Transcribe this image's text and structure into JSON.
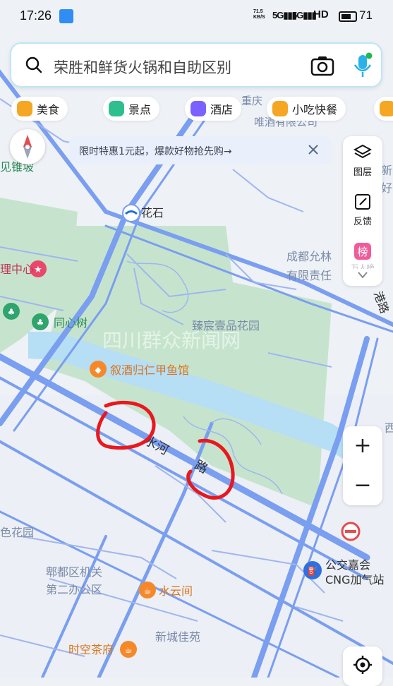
{
  "status_bar": {
    "time": "17:26",
    "net_speed_value": "71.5",
    "net_speed_unit": "KB/S",
    "signal_1": "5G",
    "signal_2": "5G",
    "hd": "HD",
    "battery": "71"
  },
  "search": {
    "query": "荣胜和鲜货火锅和自助区别"
  },
  "categories": [
    {
      "label": "美食",
      "color": "#f5a623"
    },
    {
      "label": "景点",
      "color": "#2fbf8f"
    },
    {
      "label": "酒店",
      "color": "#7b61ff"
    },
    {
      "label": "小吃快餐",
      "color": "#f5a623"
    }
  ],
  "notice": {
    "text": "限时特惠1元起，爆款好物抢先购→"
  },
  "side_panel": {
    "layers_label": "图层",
    "feedback_label": "反馈",
    "rank_badge": "榜",
    "rank_label": "万人榜"
  },
  "zoom": {
    "in_label": "+",
    "out_label": "−"
  },
  "map_labels": {
    "huashi": "花石",
    "top_company": "重庆",
    "top_company_2": "唯酒有限公司",
    "leftedge_top": "见锥坡",
    "rightedge_top_1": "新",
    "rightedge_top_2": "好",
    "chengdu_1": "成都允林",
    "chengdu_2": "有限责任",
    "leftedge_center": "理中心",
    "tongxinshu": "同心树",
    "zhenchen": "臻宸壹品花园",
    "watermark": "四川群众新闻网",
    "jiujiu": "叙酒归仁甲鱼馆",
    "road_vertical": "港路",
    "road_shuihe": "水河",
    "road_lu": "路",
    "xi": "西",
    "leftedge_garden": "色花园",
    "bus_station_1": "公交嘉会",
    "bus_station_2": "CNG加气站",
    "pidu_1": "郫都区机关",
    "pidu_2": "第二办公区",
    "shuiyunjian": "水云间",
    "xincheng": "新城佳苑",
    "shikong": "时空茶府"
  },
  "colors": {
    "road_main": "#7a9ef0",
    "road_minor": "#9fb6ee",
    "river": "#b6def5",
    "park": "#c6e4cd",
    "poi_orange": "#f5892a",
    "annotation": "#e8181e"
  }
}
